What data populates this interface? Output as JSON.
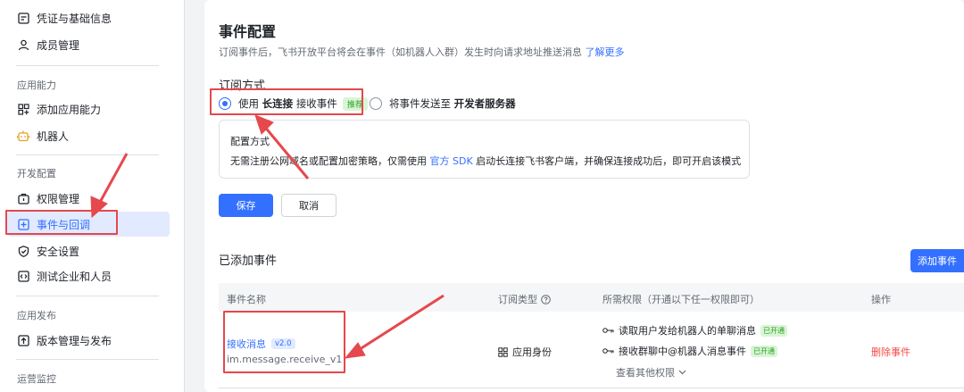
{
  "sidebar": {
    "items_top": [
      {
        "label": "凭证与基础信息",
        "icon": "credential-icon"
      },
      {
        "label": "成员管理",
        "icon": "member-icon"
      }
    ],
    "sections": [
      {
        "title": "应用能力"
      },
      {
        "title": "开发配置"
      },
      {
        "title": "应用发布"
      },
      {
        "title": "运营监控"
      }
    ],
    "items_cap": [
      {
        "label": "添加应用能力",
        "icon": "grid-add-icon"
      },
      {
        "label": "机器人",
        "icon": "robot-icon"
      }
    ],
    "items_dev": [
      {
        "label": "权限管理",
        "icon": "permission-icon"
      },
      {
        "label": "事件与回调",
        "icon": "event-icon"
      },
      {
        "label": "安全设置",
        "icon": "shield-icon"
      },
      {
        "label": "测试企业和人员",
        "icon": "test-icon"
      }
    ],
    "items_pub": [
      {
        "label": "版本管理与发布",
        "icon": "upload-icon"
      }
    ]
  },
  "main": {
    "title": "事件配置",
    "desc": "订阅事件后，飞书开放平台将会在事件（如机器人入群）发生时向请求地址推送消息",
    "desc_link": "了解更多",
    "sub_title": "订阅方式",
    "option1_prefix": "使用",
    "option1_bold": "长连接",
    "option1_suffix": "接收事件",
    "option1_tag": "推荐",
    "option2_prefix": "将事件发送至",
    "option2_bold": "开发者服务器",
    "config_title": "配置方式",
    "config_desc_prefix": "无需注册公网域名或配置加密策略，仅需使用",
    "config_desc_link": "官方 SDK",
    "config_desc_suffix": "启动长连接飞书客户端，并确保连接成功后，即可开启该模式",
    "save": "保存",
    "cancel": "取消",
    "added_title": "已添加事件",
    "add_btn": "添加事件"
  },
  "table": {
    "headers": [
      "事件名称",
      "订阅类型",
      "所需权限（开通以下任一权限即可）",
      "操作"
    ],
    "row": {
      "name": "接收消息",
      "version": "v2.0",
      "code": "im.message.receive_v1",
      "sub_type": "应用身份",
      "perms": [
        {
          "label": "读取用户发给机器人的单聊消息",
          "status": "已开通"
        },
        {
          "label": "接收群聊中@机器人消息事件",
          "status": "已开通"
        }
      ],
      "more": "查看其他权限",
      "action": "删除事件"
    }
  },
  "colors": {
    "accent": "#3370ff",
    "danger": "#f54a45",
    "highlight": "#e5484d"
  }
}
